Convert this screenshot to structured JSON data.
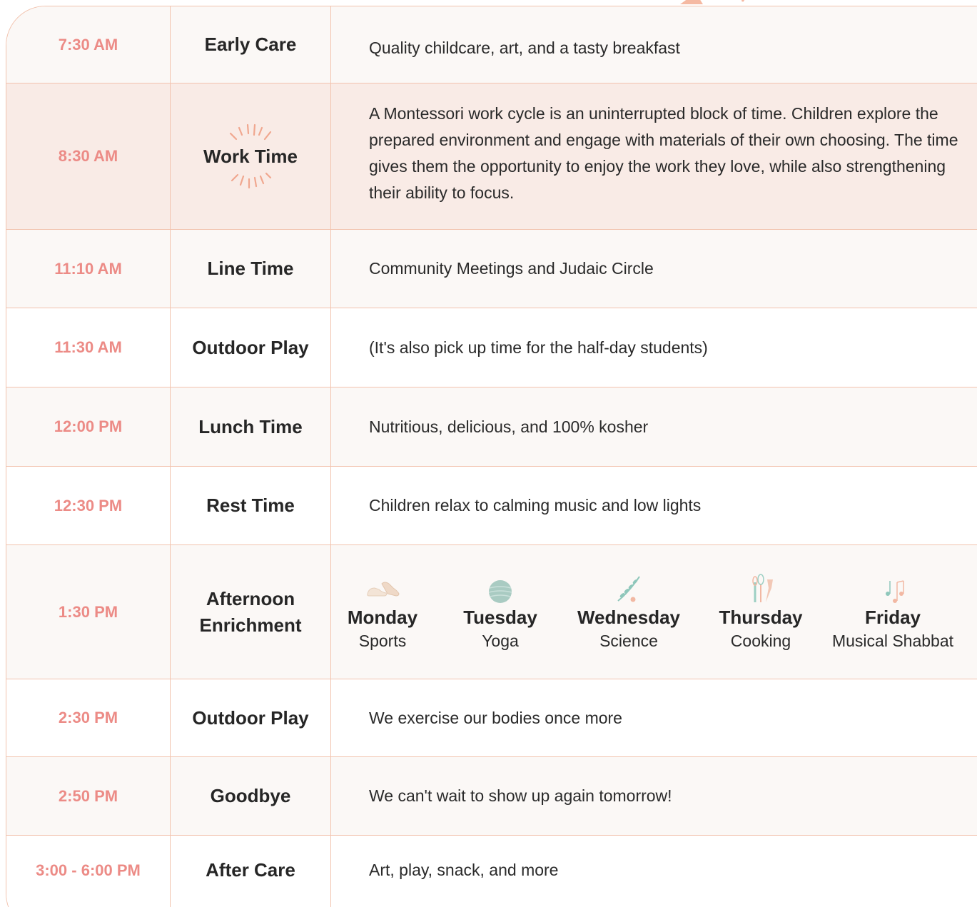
{
  "schedule": [
    {
      "time": "7:30 AM",
      "name": "Early Care",
      "desc": "Quality childcare, art, and a tasty breakfast"
    },
    {
      "time": "8:30 AM",
      "name": "Work Time",
      "desc": "A Montessori work cycle is an uninterrupted block of time. Children explore the prepared environment and engage with materials of their own choosing. The time gives them the opportunity to enjoy the work they love, while also strengthening their ability to focus."
    },
    {
      "time": "11:10 AM",
      "name": "Line Time",
      "desc": "Community Meetings and Judaic Circle"
    },
    {
      "time": "11:30 AM",
      "name": "Outdoor Play",
      "desc": "(It's also pick up time for the half-day students)"
    },
    {
      "time": "12:00 PM",
      "name": "Lunch Time",
      "desc": "Nutritious, delicious, and 100% kosher"
    },
    {
      "time": "12:30 PM",
      "name": "Rest Time",
      "desc": "Children relax to calming music and low lights"
    },
    {
      "time": "1:30 PM",
      "name": "Afternoon Enrichment",
      "desc": ""
    },
    {
      "time": "2:30 PM",
      "name": "Outdoor Play",
      "desc": "We exercise our bodies once more"
    },
    {
      "time": "2:50 PM",
      "name": "Goodbye",
      "desc": "We can't wait to show up again tomorrow!"
    },
    {
      "time": "3:00 - 6:00 PM",
      "name": "After Care",
      "desc": "Art, play, snack, and more"
    }
  ],
  "enrichment": [
    {
      "day": "Monday",
      "activity": "Sports",
      "icon": "sneakers-icon"
    },
    {
      "day": "Tuesday",
      "activity": "Yoga",
      "icon": "yoga-ball-icon"
    },
    {
      "day": "Wednesday",
      "activity": "Science",
      "icon": "plant-icon"
    },
    {
      "day": "Thursday",
      "activity": "Cooking",
      "icon": "kitchen-utensils-icon"
    },
    {
      "day": "Friday",
      "activity": "Musical Shabbat",
      "icon": "music-notes-icon"
    }
  ],
  "colors": {
    "accent": "#ec8b86",
    "border": "#f2c3ae",
    "highlight": "#f9ebe6",
    "row": "#fbf8f6"
  }
}
